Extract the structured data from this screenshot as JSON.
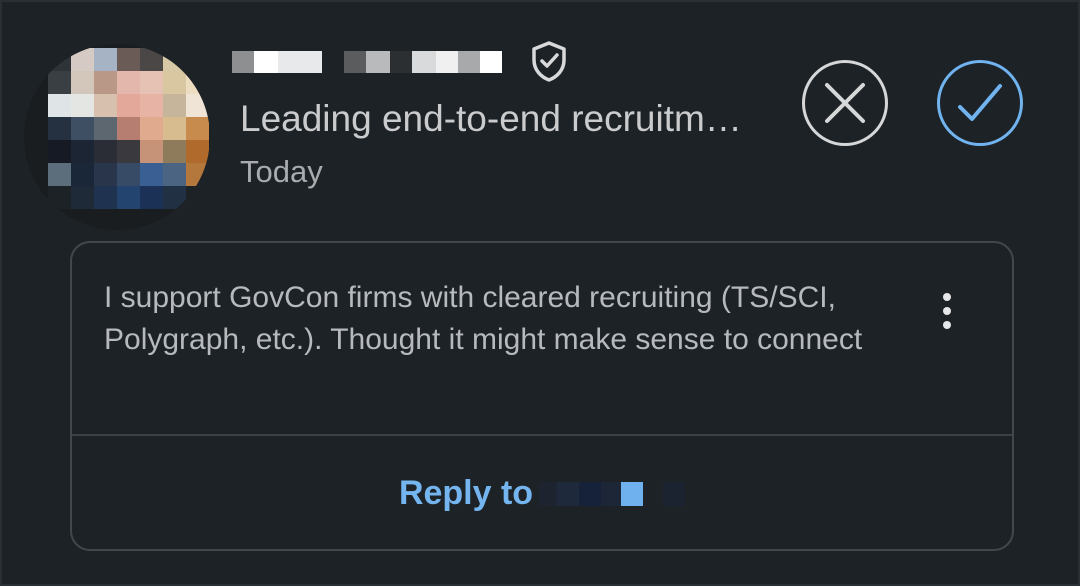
{
  "invitation": {
    "sender_name_redacted": true,
    "headline": "Leading end-to-end recruitm…",
    "time": "Today",
    "message": "I support GovCon firms with cleared recruiting (TS/SCI, Polygraph, etc.). Thought it might make sense to connect",
    "reply_label": "Reply to",
    "verified_icon": "shield-check-icon",
    "ignore_icon": "close-icon",
    "accept_icon": "check-icon",
    "more_icon": "more-vertical-icon",
    "colors": {
      "background": "#1d2226",
      "accent": "#70b3ef",
      "text_primary": "#c9cbcd",
      "text_secondary": "#a9acaf"
    }
  }
}
